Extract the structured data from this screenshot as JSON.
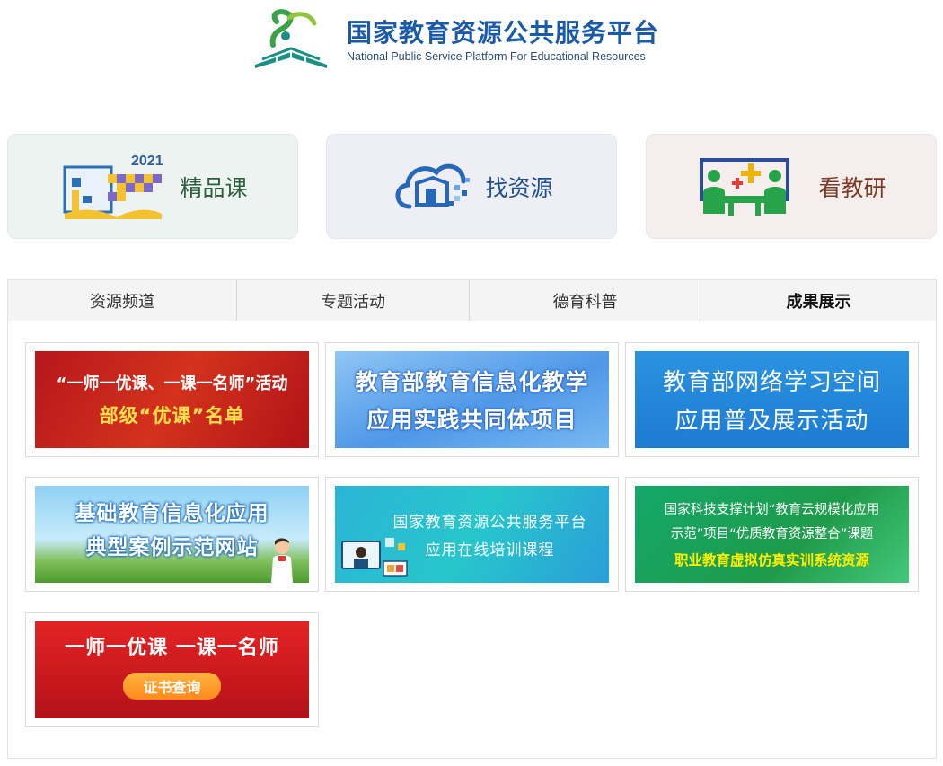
{
  "header": {
    "logo_cn": "国家教育资源公共服务平台",
    "logo_en": "National Public Service Platform For Educational Resources"
  },
  "quick_cards": [
    {
      "label": "精品课",
      "icon": "open-book-2021-icon",
      "icon_badge": "2021"
    },
    {
      "label": "找资源",
      "icon": "cloud-resource-icon"
    },
    {
      "label": "看教研",
      "icon": "teaching-research-icon"
    }
  ],
  "tabs": [
    {
      "label": "资源频道"
    },
    {
      "label": "专题活动"
    },
    {
      "label": "德育科普"
    },
    {
      "label": "成果展示",
      "active": true
    }
  ],
  "banners": {
    "b1": {
      "line1": "“一师一优课、一课一名师”活动",
      "line2": "部级“优课”名单"
    },
    "b2": {
      "line1": "教育部教育信息化教学",
      "line2": "应用实践共同体项目"
    },
    "b3": {
      "line1": "教育部网络学习空间",
      "line2": "应用普及展示活动"
    },
    "b4": {
      "line1": "基础教育信息化应用",
      "line2": "典型案例示范网站"
    },
    "b5": {
      "line1": "国家教育资源公共服务平台",
      "line2": "应用在线培训课程"
    },
    "b6": {
      "line1": "国家科技支撑计划“教育云规模化应用",
      "line2": "示范”项目“优质教育资源整合”课题",
      "line3": "职业教育虚拟仿真实训系统资源"
    },
    "b7": {
      "line1": "一师一优课 一课一名师",
      "button": "证书查询"
    }
  },
  "colors": {
    "brand_blue": "#1b5aa7",
    "logo_teal": "#1a8f86",
    "logo_green": "#3aa348"
  }
}
